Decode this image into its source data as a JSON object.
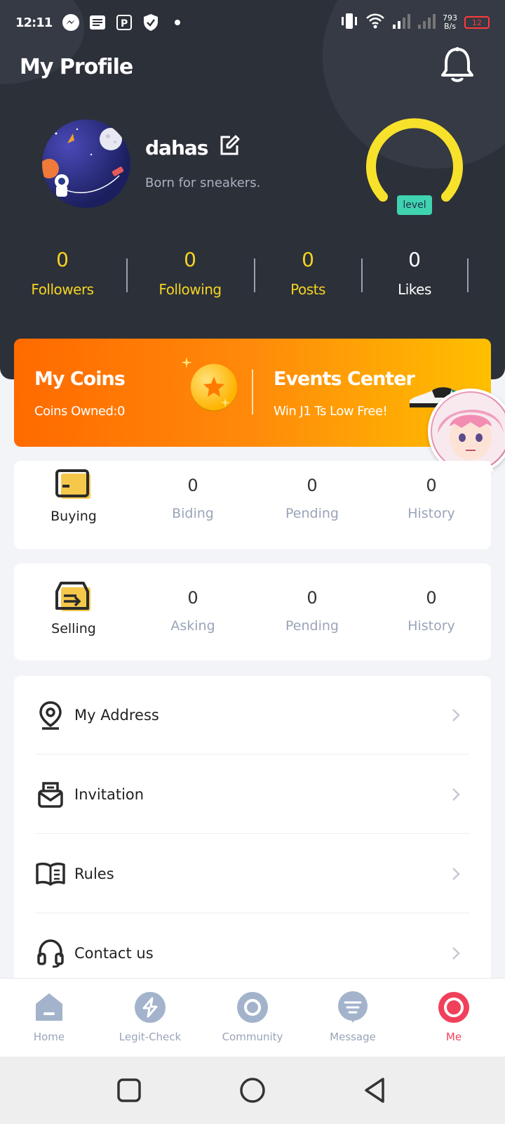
{
  "status_bar": {
    "time": "12:11",
    "net_rate_top": "793",
    "net_rate_bottom": "B/s",
    "battery": "12"
  },
  "header": {
    "title": "My Profile",
    "username": "dahas",
    "bio": "Born for sneakers.",
    "level_label": "level"
  },
  "stats": [
    {
      "value": "0",
      "label": "Followers"
    },
    {
      "value": "0",
      "label": "Following"
    },
    {
      "value": "0",
      "label": "Posts"
    },
    {
      "value": "0",
      "label": "Likes"
    }
  ],
  "banner": {
    "coins_title": "My Coins",
    "coins_sub": "Coins Owned:0",
    "events_title": "Events Center",
    "events_sub": "Win J1 Ts Low Free!"
  },
  "buying": {
    "label": "Buying",
    "items": [
      {
        "value": "0",
        "label": "Biding"
      },
      {
        "value": "0",
        "label": "Pending"
      },
      {
        "value": "0",
        "label": "History"
      }
    ]
  },
  "selling": {
    "label": "Selling",
    "items": [
      {
        "value": "0",
        "label": "Asking"
      },
      {
        "value": "0",
        "label": "Pending"
      },
      {
        "value": "0",
        "label": "History"
      }
    ]
  },
  "menu": [
    {
      "label": "My Address",
      "icon": "location-pin-icon"
    },
    {
      "label": "Invitation",
      "icon": "envelope-icon"
    },
    {
      "label": "Rules",
      "icon": "book-icon"
    },
    {
      "label": "Contact us",
      "icon": "headset-icon"
    }
  ],
  "tabs": [
    {
      "label": "Home",
      "icon": "home-icon"
    },
    {
      "label": "Legit-Check",
      "icon": "legit-check-icon"
    },
    {
      "label": "Community",
      "icon": "community-icon"
    },
    {
      "label": "Message",
      "icon": "message-icon"
    },
    {
      "label": "Me",
      "icon": "me-icon"
    }
  ],
  "colors": {
    "header_bg": "#2c3039",
    "accent_yellow": "#f5d421",
    "level_badge": "#3fd3b0",
    "banner_start": "#ff6a00",
    "banner_end": "#ffbf00",
    "active_tab": "#f0405a",
    "inactive_tab": "#9aa4b8"
  }
}
